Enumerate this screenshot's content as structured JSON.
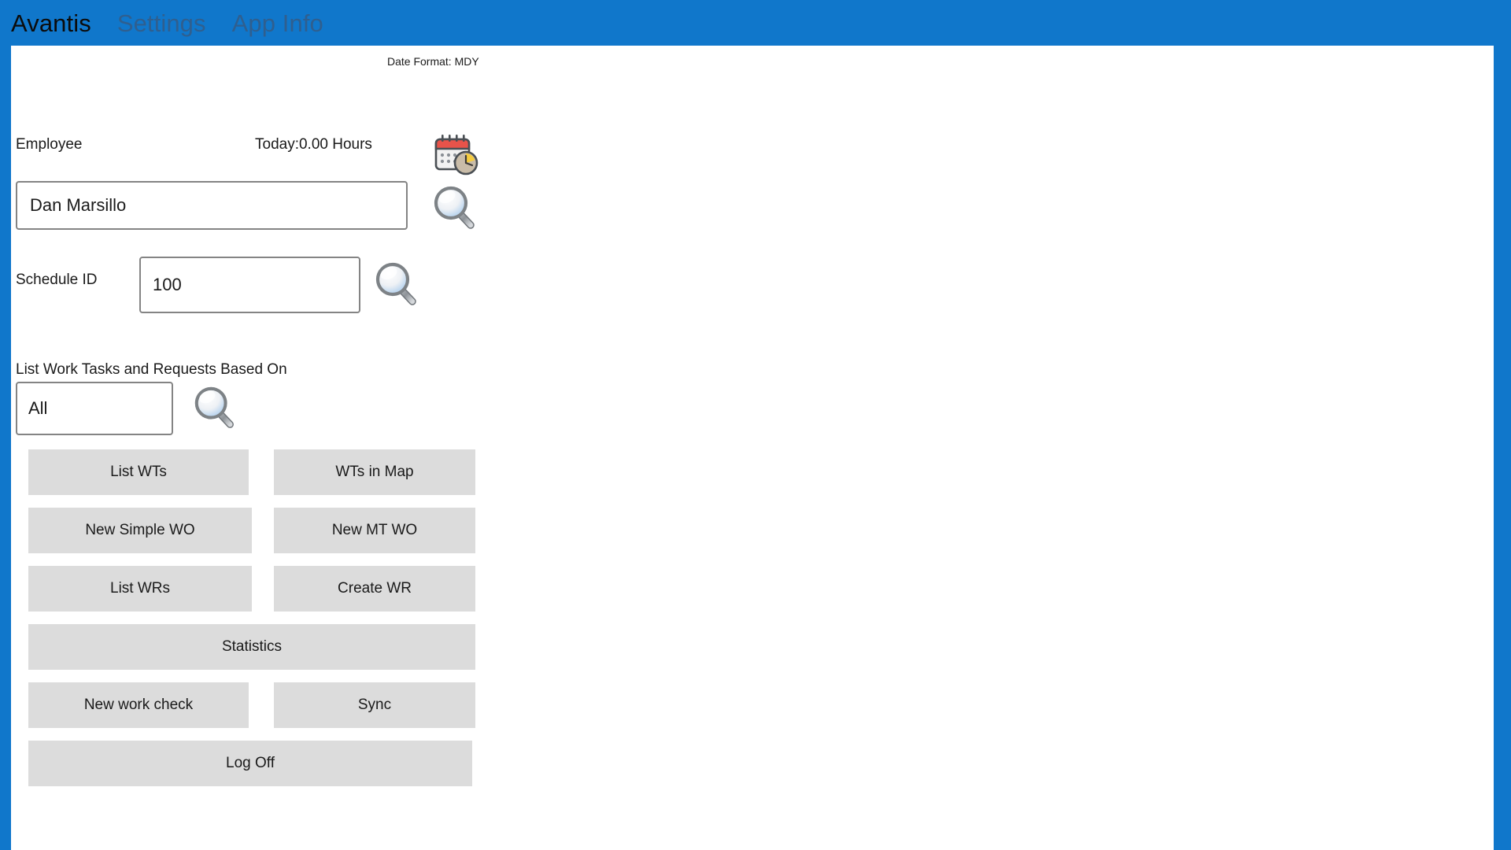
{
  "nav": {
    "items": [
      {
        "label": "Avantis",
        "state": "active"
      },
      {
        "label": "Settings",
        "state": "inactive"
      },
      {
        "label": "App Info",
        "state": "inactive"
      }
    ]
  },
  "header": {
    "date_format_note": "Date Format: MDY"
  },
  "form": {
    "employee_label": "Employee",
    "hours_today": "Today:0.00 Hours",
    "employee_value": "Dan Marsillo",
    "employee_placeholder": "",
    "schedule_label": "Schedule ID",
    "schedule_value": "100",
    "schedule_placeholder": "",
    "filter_label": "List Work Tasks and Requests Based On",
    "filter_value": "All",
    "filter_placeholder": ""
  },
  "icons": {
    "calendar_clock": "calendar-clock-icon",
    "employee_search": "search-icon",
    "schedule_search": "search-icon",
    "filter_search": "search-icon"
  },
  "buttons": {
    "list_wts": "List WTs",
    "wts_in_map": "WTs in Map",
    "new_simple_wo": "New Simple WO",
    "new_mt_wo": "New MT WO",
    "list_wrs": "List WRs",
    "create_wr": "Create WR",
    "statistics": "Statistics",
    "new_work_check": "New work check",
    "sync": "Sync",
    "log_off": "Log Off"
  },
  "colors": {
    "accent_blue": "#1077cb",
    "button_gray": "#dcdcdc",
    "input_border": "#848484",
    "text": "#1a1a1a",
    "nav_inactive": "#2f5f8f",
    "calendar_red": "#e8534a",
    "clock_yellow": "#f5cc3f"
  }
}
